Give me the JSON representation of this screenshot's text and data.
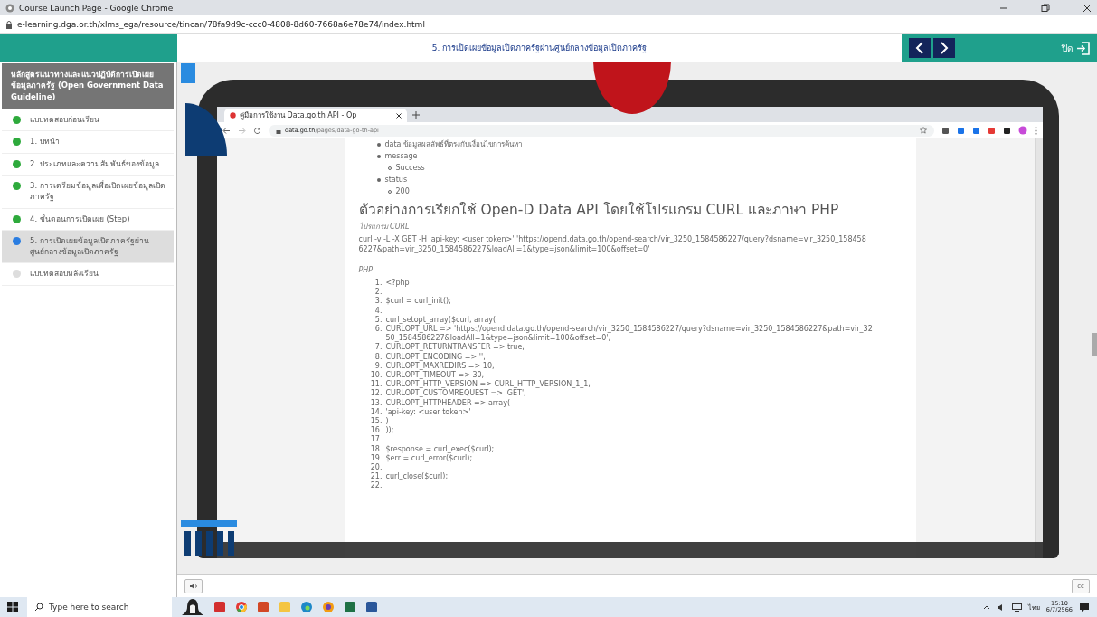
{
  "window": {
    "title": "Course Launch Page - Google Chrome",
    "url": "e-learning.dga.or.th/xlms_ega/resource/tincan/78fa9d9c-ccc0-4808-8d60-7668a6e78e74/index.html"
  },
  "header": {
    "lesson_title": "5. การเปิดเผยข้อมูลเปิดภาครัฐผ่านศูนย์กลางข้อมูลเปิดภาครัฐ",
    "close_label": "ปิด"
  },
  "sidebar": {
    "course_title": "หลักสูตรแนวทางและแนวปฏิบัติการเปิดเผยข้อมูลภาครัฐ (Open Government Data Guideline)",
    "items": [
      {
        "label": "แบบทดสอบก่อนเรียน",
        "color": "#2eaa3c",
        "selected": false
      },
      {
        "label": "1. บทนำ",
        "color": "#2eaa3c",
        "selected": false
      },
      {
        "label": "2. ประเภทและความสัมพันธ์ของข้อมูล",
        "color": "#2eaa3c",
        "selected": false
      },
      {
        "label": "3. การเตรียมข้อมูลเพื่อเปิดเผยข้อมูลเปิดภาครัฐ",
        "color": "#2eaa3c",
        "selected": false
      },
      {
        "label": "4. ขั้นตอนการเปิดเผย (Step)",
        "color": "#2eaa3c",
        "selected": false
      },
      {
        "label": "5. การเปิดเผยข้อมูลเปิดภาครัฐผ่านศูนย์กลางข้อมูลเปิดภาครัฐ",
        "color": "#2a7de1",
        "selected": true
      },
      {
        "label": "แบบทดสอบหลังเรียน",
        "color": "#dddddd",
        "selected": false
      }
    ]
  },
  "video": {
    "browser": {
      "tab_title": "คู่มือการใช้งาน Data.go.th API - Op",
      "url_host": "data.go.th",
      "url_path": "/pages/data-go-th-api",
      "bullets": [
        {
          "text": "data  ข้อมูลผลลัพธ์ที่ตรงกับเงื่อนไขการค้นหา"
        },
        {
          "text": "message",
          "children": [
            "Success"
          ]
        },
        {
          "text": "status",
          "children": [
            "200"
          ]
        }
      ],
      "heading": "ตัวอย่างการเรียกใช้ Open-D Data API โดยใช้โปรแกรม CURL และภาษา PHP",
      "subheading": "โปรแกรม CURL",
      "curl_command": "curl -v -L -X GET -H 'api-key: <user token>' 'https://opend.data.go.th/opend-search/vir_3250_1584586227/query?dsname=vir_3250_1584586227&path=vir_3250_1584586227&loadAll=1&type=json&limit=100&offset=0'",
      "php_label": "PHP",
      "code_lines": [
        {
          "number": "1.",
          "text": "<?php"
        },
        {
          "number": "2."
        },
        {
          "number": "3.",
          "text": "$curl = curl_init();"
        },
        {
          "number": "4."
        },
        {
          "number": "5.",
          "text": "curl_setopt_array($curl, array("
        },
        {
          "number": "6.",
          "text": "CURLOPT_URL => 'https://opend.data.go.th/opend-search/vir_3250_1584586227/query?dsname=vir_3250_1584586227&path=vir_3250_1584586227&loadAll=1&type=json&limit=100&offset=0',"
        },
        {
          "number": "7.",
          "text": "CURLOPT_RETURNTRANSFER => true,"
        },
        {
          "number": "8.",
          "text": "CURLOPT_ENCODING => '',"
        },
        {
          "number": "9.",
          "text": "CURLOPT_MAXREDIRS => 10,"
        },
        {
          "number": "10.",
          "text": "CURLOPT_TIMEOUT => 30,"
        },
        {
          "number": "11.",
          "text": "CURLOPT_HTTP_VERSION => CURL_HTTP_VERSION_1_1,"
        },
        {
          "number": "12.",
          "text": "CURLOPT_CUSTOMREQUEST => 'GET',"
        },
        {
          "number": "13.",
          "text": "CURLOPT_HTTPHEADER => array("
        },
        {
          "number": "14.",
          "text": "'api-key: <user token>'"
        },
        {
          "number": "15.",
          "text": ")"
        },
        {
          "number": "16.",
          "text": "));"
        },
        {
          "number": "17."
        },
        {
          "number": "18.",
          "text": "$response = curl_exec($curl);"
        },
        {
          "number": "19.",
          "text": "$err = curl_error($curl);"
        },
        {
          "number": "20."
        },
        {
          "number": "21.",
          "text": "curl_close($curl);"
        },
        {
          "number": "22."
        }
      ]
    },
    "cc_label": "cc"
  },
  "taskbar": {
    "search_placeholder": "Type here to search",
    "language": "ไทย",
    "time": "15:10",
    "date": "6/7/2566"
  }
}
